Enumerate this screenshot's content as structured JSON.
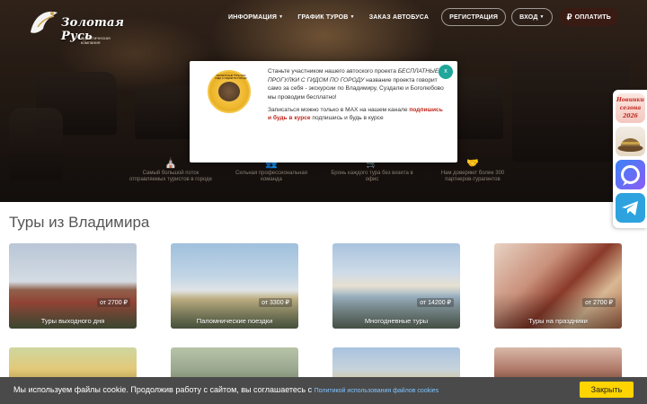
{
  "brand": {
    "name": "Золотая Русь",
    "tagline": "туристическая компания"
  },
  "nav": {
    "items": [
      {
        "label": "Информация",
        "has_caret": true
      },
      {
        "label": "График туров",
        "has_caret": true
      },
      {
        "label": "Заказ автобуса",
        "has_caret": false
      }
    ],
    "register_label": "Регистрация",
    "login_label": "Вход",
    "pay_label": "Оплатить",
    "pay_icon": "ruble-icon"
  },
  "features": [
    {
      "icon": "church-icon",
      "text": "Самый большой поток отправляемых туристов в городе"
    },
    {
      "icon": "people-icon",
      "text": "Сильная профессиональная команда"
    },
    {
      "icon": "cart-icon",
      "text": "Бронь каждого тура без визита в офис"
    },
    {
      "icon": "handshake-icon",
      "text": "Нам доверяют более 300 партнеров-турагентов"
    }
  ],
  "popup": {
    "badge_text": "АВТОБУСНЫЕ ТУРЫ БЕЗ ГИДА С ГИДОМ ПО ГОРОДУ",
    "para1_a": "Станьте участником нашего автоского проекта",
    "para1_b": "БЕСПЛАТНЫЕ ПРОГУЛКИ С ГИДОМ ПО ГОРОДУ",
    "para1_c": "название проекта говорит само за себя - экскурсии по Владимиру, Суздалю и Боголюбово мы проводим бесплатно!",
    "para2_a": "Записаться можно только в MAX на нашем канале",
    "para2_link": "подпишись и будь в курсе",
    "para2_b": "подпишись и будь в курсе",
    "close_label": "x"
  },
  "section": {
    "title": "Туры из Владимира"
  },
  "cards": [
    {
      "title": "Туры выходного дня",
      "price": "от 2700 ₽"
    },
    {
      "title": "Паломнические поездки",
      "price": "от 3300 ₽"
    },
    {
      "title": "Многодневные туры",
      "price": "от 14200 ₽"
    },
    {
      "title": "Туры на праздники",
      "price": "от 2700 ₽"
    }
  ],
  "side": {
    "new_line1": "Новинки",
    "new_line2": "сезона",
    "new_line3": "2026"
  },
  "cookie": {
    "text": "Мы используем файлы cookie. Продолжив работу с сайтом, вы соглашаетесь с",
    "link": "Политикой использования файлов cookies",
    "button": "Закрыть"
  },
  "colors": {
    "accent_teal": "#20a69a",
    "link_red": "#c0261c",
    "cookie_button": "#ffd400",
    "cookie_bar": "#4a4a4a"
  }
}
